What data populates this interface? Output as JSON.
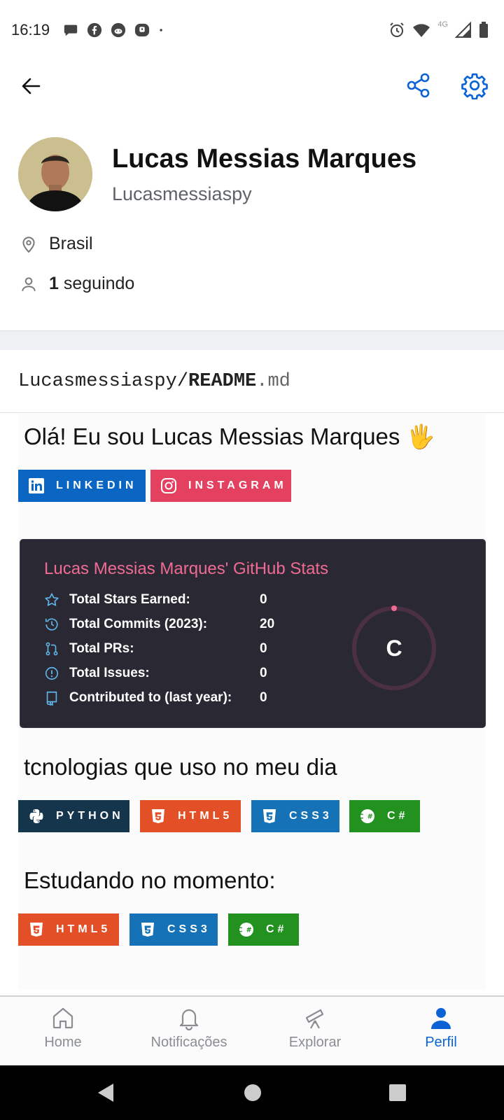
{
  "status_bar": {
    "time": "16:19",
    "network": "4G"
  },
  "app_bar": {
    "back_icon": "arrow-left-icon",
    "share_icon": "share-icon",
    "settings_icon": "gear-icon"
  },
  "profile": {
    "name": "Lucas Messias Marques",
    "login": "Lucasmessiaspy",
    "location": "Brasil",
    "following_count": "1",
    "following_label": "seguindo"
  },
  "readme": {
    "owner": "Lucasmessiaspy/",
    "file": "README",
    "ext": ".md",
    "heading_intro": "Olá! Eu sou Lucas Messias Marques 🖐",
    "social_badges": [
      {
        "label": "LINKEDIN",
        "color": "#0a66c2",
        "icon": "linkedin-icon"
      },
      {
        "label": "INSTAGRAM",
        "color": "#e4405f",
        "icon": "instagram-icon"
      }
    ],
    "stats": {
      "title": "Lucas Messias Marques' GitHub Stats",
      "rows": [
        {
          "label": "Total Stars Earned:",
          "value": "0",
          "icon": "star-icon"
        },
        {
          "label": "Total Commits (2023):",
          "value": "20",
          "icon": "history-icon"
        },
        {
          "label": "Total PRs:",
          "value": "0",
          "icon": "pull-request-icon"
        },
        {
          "label": "Total Issues:",
          "value": "0",
          "icon": "issue-icon"
        },
        {
          "label": "Contributed to (last year):",
          "value": "0",
          "icon": "repo-icon"
        }
      ],
      "rank": "C",
      "title_color": "#f06b93",
      "bg_color": "#2a2933"
    },
    "heading_tech": "tcnologias que uso no meu dia",
    "tech_badges": [
      {
        "label": "PYTHON",
        "color": "#14354c",
        "icon": "python-icon"
      },
      {
        "label": "HTML5",
        "color": "#e34f26",
        "icon": "html5-icon"
      },
      {
        "label": "CSS3",
        "color": "#1572b6",
        "icon": "css3-icon"
      },
      {
        "label": "C#",
        "color": "#239120",
        "icon": "csharp-icon"
      }
    ],
    "heading_study": "Estudando no momento:",
    "study_badges": [
      {
        "label": "HTML5",
        "color": "#e34f26",
        "icon": "html5-icon"
      },
      {
        "label": "CSS3",
        "color": "#1572b6",
        "icon": "css3-icon"
      },
      {
        "label": "C#",
        "color": "#239120",
        "icon": "csharp-icon"
      }
    ]
  },
  "bottom_nav": [
    {
      "label": "Home",
      "icon": "home-icon",
      "active": false
    },
    {
      "label": "Notificações",
      "icon": "bell-icon",
      "active": false
    },
    {
      "label": "Explorar",
      "icon": "telescope-icon",
      "active": false
    },
    {
      "label": "Perfil",
      "icon": "person-icon",
      "active": true
    }
  ],
  "accent_color": "#0b63d6"
}
